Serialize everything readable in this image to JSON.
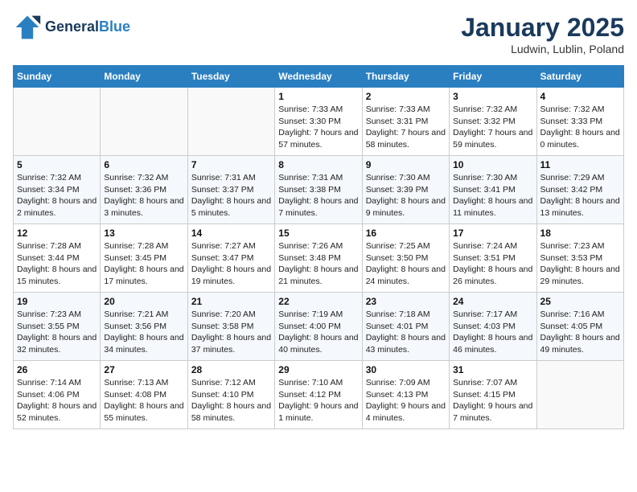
{
  "header": {
    "logo_general": "General",
    "logo_blue": "Blue",
    "month_title": "January 2025",
    "location": "Ludwin, Lublin, Poland"
  },
  "days_of_week": [
    "Sunday",
    "Monday",
    "Tuesday",
    "Wednesday",
    "Thursday",
    "Friday",
    "Saturday"
  ],
  "weeks": [
    [
      {
        "day": "",
        "info": ""
      },
      {
        "day": "",
        "info": ""
      },
      {
        "day": "",
        "info": ""
      },
      {
        "day": "1",
        "info": "Sunrise: 7:33 AM\nSunset: 3:30 PM\nDaylight: 7 hours and 57 minutes."
      },
      {
        "day": "2",
        "info": "Sunrise: 7:33 AM\nSunset: 3:31 PM\nDaylight: 7 hours and 58 minutes."
      },
      {
        "day": "3",
        "info": "Sunrise: 7:32 AM\nSunset: 3:32 PM\nDaylight: 7 hours and 59 minutes."
      },
      {
        "day": "4",
        "info": "Sunrise: 7:32 AM\nSunset: 3:33 PM\nDaylight: 8 hours and 0 minutes."
      }
    ],
    [
      {
        "day": "5",
        "info": "Sunrise: 7:32 AM\nSunset: 3:34 PM\nDaylight: 8 hours and 2 minutes."
      },
      {
        "day": "6",
        "info": "Sunrise: 7:32 AM\nSunset: 3:36 PM\nDaylight: 8 hours and 3 minutes."
      },
      {
        "day": "7",
        "info": "Sunrise: 7:31 AM\nSunset: 3:37 PM\nDaylight: 8 hours and 5 minutes."
      },
      {
        "day": "8",
        "info": "Sunrise: 7:31 AM\nSunset: 3:38 PM\nDaylight: 8 hours and 7 minutes."
      },
      {
        "day": "9",
        "info": "Sunrise: 7:30 AM\nSunset: 3:39 PM\nDaylight: 8 hours and 9 minutes."
      },
      {
        "day": "10",
        "info": "Sunrise: 7:30 AM\nSunset: 3:41 PM\nDaylight: 8 hours and 11 minutes."
      },
      {
        "day": "11",
        "info": "Sunrise: 7:29 AM\nSunset: 3:42 PM\nDaylight: 8 hours and 13 minutes."
      }
    ],
    [
      {
        "day": "12",
        "info": "Sunrise: 7:28 AM\nSunset: 3:44 PM\nDaylight: 8 hours and 15 minutes."
      },
      {
        "day": "13",
        "info": "Sunrise: 7:28 AM\nSunset: 3:45 PM\nDaylight: 8 hours and 17 minutes."
      },
      {
        "day": "14",
        "info": "Sunrise: 7:27 AM\nSunset: 3:47 PM\nDaylight: 8 hours and 19 minutes."
      },
      {
        "day": "15",
        "info": "Sunrise: 7:26 AM\nSunset: 3:48 PM\nDaylight: 8 hours and 21 minutes."
      },
      {
        "day": "16",
        "info": "Sunrise: 7:25 AM\nSunset: 3:50 PM\nDaylight: 8 hours and 24 minutes."
      },
      {
        "day": "17",
        "info": "Sunrise: 7:24 AM\nSunset: 3:51 PM\nDaylight: 8 hours and 26 minutes."
      },
      {
        "day": "18",
        "info": "Sunrise: 7:23 AM\nSunset: 3:53 PM\nDaylight: 8 hours and 29 minutes."
      }
    ],
    [
      {
        "day": "19",
        "info": "Sunrise: 7:23 AM\nSunset: 3:55 PM\nDaylight: 8 hours and 32 minutes."
      },
      {
        "day": "20",
        "info": "Sunrise: 7:21 AM\nSunset: 3:56 PM\nDaylight: 8 hours and 34 minutes."
      },
      {
        "day": "21",
        "info": "Sunrise: 7:20 AM\nSunset: 3:58 PM\nDaylight: 8 hours and 37 minutes."
      },
      {
        "day": "22",
        "info": "Sunrise: 7:19 AM\nSunset: 4:00 PM\nDaylight: 8 hours and 40 minutes."
      },
      {
        "day": "23",
        "info": "Sunrise: 7:18 AM\nSunset: 4:01 PM\nDaylight: 8 hours and 43 minutes."
      },
      {
        "day": "24",
        "info": "Sunrise: 7:17 AM\nSunset: 4:03 PM\nDaylight: 8 hours and 46 minutes."
      },
      {
        "day": "25",
        "info": "Sunrise: 7:16 AM\nSunset: 4:05 PM\nDaylight: 8 hours and 49 minutes."
      }
    ],
    [
      {
        "day": "26",
        "info": "Sunrise: 7:14 AM\nSunset: 4:06 PM\nDaylight: 8 hours and 52 minutes."
      },
      {
        "day": "27",
        "info": "Sunrise: 7:13 AM\nSunset: 4:08 PM\nDaylight: 8 hours and 55 minutes."
      },
      {
        "day": "28",
        "info": "Sunrise: 7:12 AM\nSunset: 4:10 PM\nDaylight: 8 hours and 58 minutes."
      },
      {
        "day": "29",
        "info": "Sunrise: 7:10 AM\nSunset: 4:12 PM\nDaylight: 9 hours and 1 minute."
      },
      {
        "day": "30",
        "info": "Sunrise: 7:09 AM\nSunset: 4:13 PM\nDaylight: 9 hours and 4 minutes."
      },
      {
        "day": "31",
        "info": "Sunrise: 7:07 AM\nSunset: 4:15 PM\nDaylight: 9 hours and 7 minutes."
      },
      {
        "day": "",
        "info": ""
      }
    ]
  ]
}
